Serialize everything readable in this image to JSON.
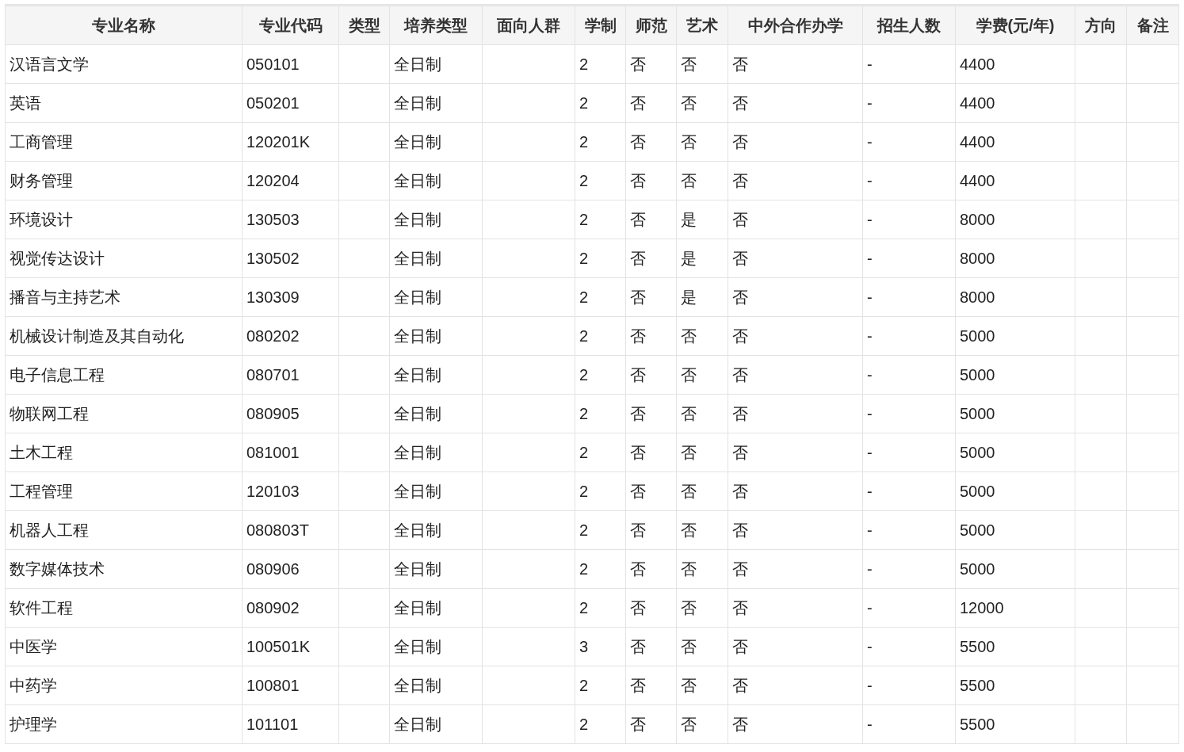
{
  "table": {
    "columns": [
      "专业名称",
      "专业代码",
      "类型",
      "培养类型",
      "面向人群",
      "学制",
      "师范",
      "艺术",
      "中外合作办学",
      "招生人数",
      "学费(元/年)",
      "方向",
      "备注"
    ],
    "rows": [
      [
        "汉语言文学",
        "050101",
        null,
        "全日制",
        null,
        "2",
        "否",
        "否",
        "否",
        "-",
        "4400",
        null,
        null
      ],
      [
        "英语",
        "050201",
        null,
        "全日制",
        null,
        "2",
        "否",
        "否",
        "否",
        "-",
        "4400",
        null,
        null
      ],
      [
        "工商管理",
        "120201K",
        null,
        "全日制",
        null,
        "2",
        "否",
        "否",
        "否",
        "-",
        "4400",
        null,
        null
      ],
      [
        "财务管理",
        "120204",
        null,
        "全日制",
        null,
        "2",
        "否",
        "否",
        "否",
        "-",
        "4400",
        null,
        null
      ],
      [
        "环境设计",
        "130503",
        null,
        "全日制",
        null,
        "2",
        "否",
        "是",
        "否",
        "-",
        "8000",
        null,
        null
      ],
      [
        "视觉传达设计",
        "130502",
        null,
        "全日制",
        null,
        "2",
        "否",
        "是",
        "否",
        "-",
        "8000",
        null,
        null
      ],
      [
        "播音与主持艺术",
        "130309",
        null,
        "全日制",
        null,
        "2",
        "否",
        "是",
        "否",
        "-",
        "8000",
        null,
        null
      ],
      [
        "机械设计制造及其自动化",
        "080202",
        null,
        "全日制",
        null,
        "2",
        "否",
        "否",
        "否",
        "-",
        "5000",
        null,
        null
      ],
      [
        "电子信息工程",
        "080701",
        null,
        "全日制",
        null,
        "2",
        "否",
        "否",
        "否",
        "-",
        "5000",
        null,
        null
      ],
      [
        "物联网工程",
        "080905",
        null,
        "全日制",
        null,
        "2",
        "否",
        "否",
        "否",
        "-",
        "5000",
        null,
        null
      ],
      [
        "土木工程",
        "081001",
        null,
        "全日制",
        null,
        "2",
        "否",
        "否",
        "否",
        "-",
        "5000",
        null,
        null
      ],
      [
        "工程管理",
        "120103",
        null,
        "全日制",
        null,
        "2",
        "否",
        "否",
        "否",
        "-",
        "5000",
        null,
        null
      ],
      [
        "机器人工程",
        "080803T",
        null,
        "全日制",
        null,
        "2",
        "否",
        "否",
        "否",
        "-",
        "5000",
        null,
        null
      ],
      [
        "数字媒体技术",
        "080906",
        null,
        "全日制",
        null,
        "2",
        "否",
        "否",
        "否",
        "-",
        "5000",
        null,
        null
      ],
      [
        "软件工程",
        "080902",
        null,
        "全日制",
        null,
        "2",
        "否",
        "否",
        "否",
        "-",
        "12000",
        null,
        null
      ],
      [
        "中医学",
        "100501K",
        null,
        "全日制",
        null,
        "3",
        "否",
        "否",
        "否",
        "-",
        "5500",
        null,
        null
      ],
      [
        "中药学",
        "100801",
        null,
        "全日制",
        null,
        "2",
        "否",
        "否",
        "否",
        "-",
        "5500",
        null,
        null
      ],
      [
        "护理学",
        "101101",
        null,
        "全日制",
        null,
        "2",
        "否",
        "否",
        "否",
        "-",
        "5500",
        null,
        null
      ]
    ]
  }
}
